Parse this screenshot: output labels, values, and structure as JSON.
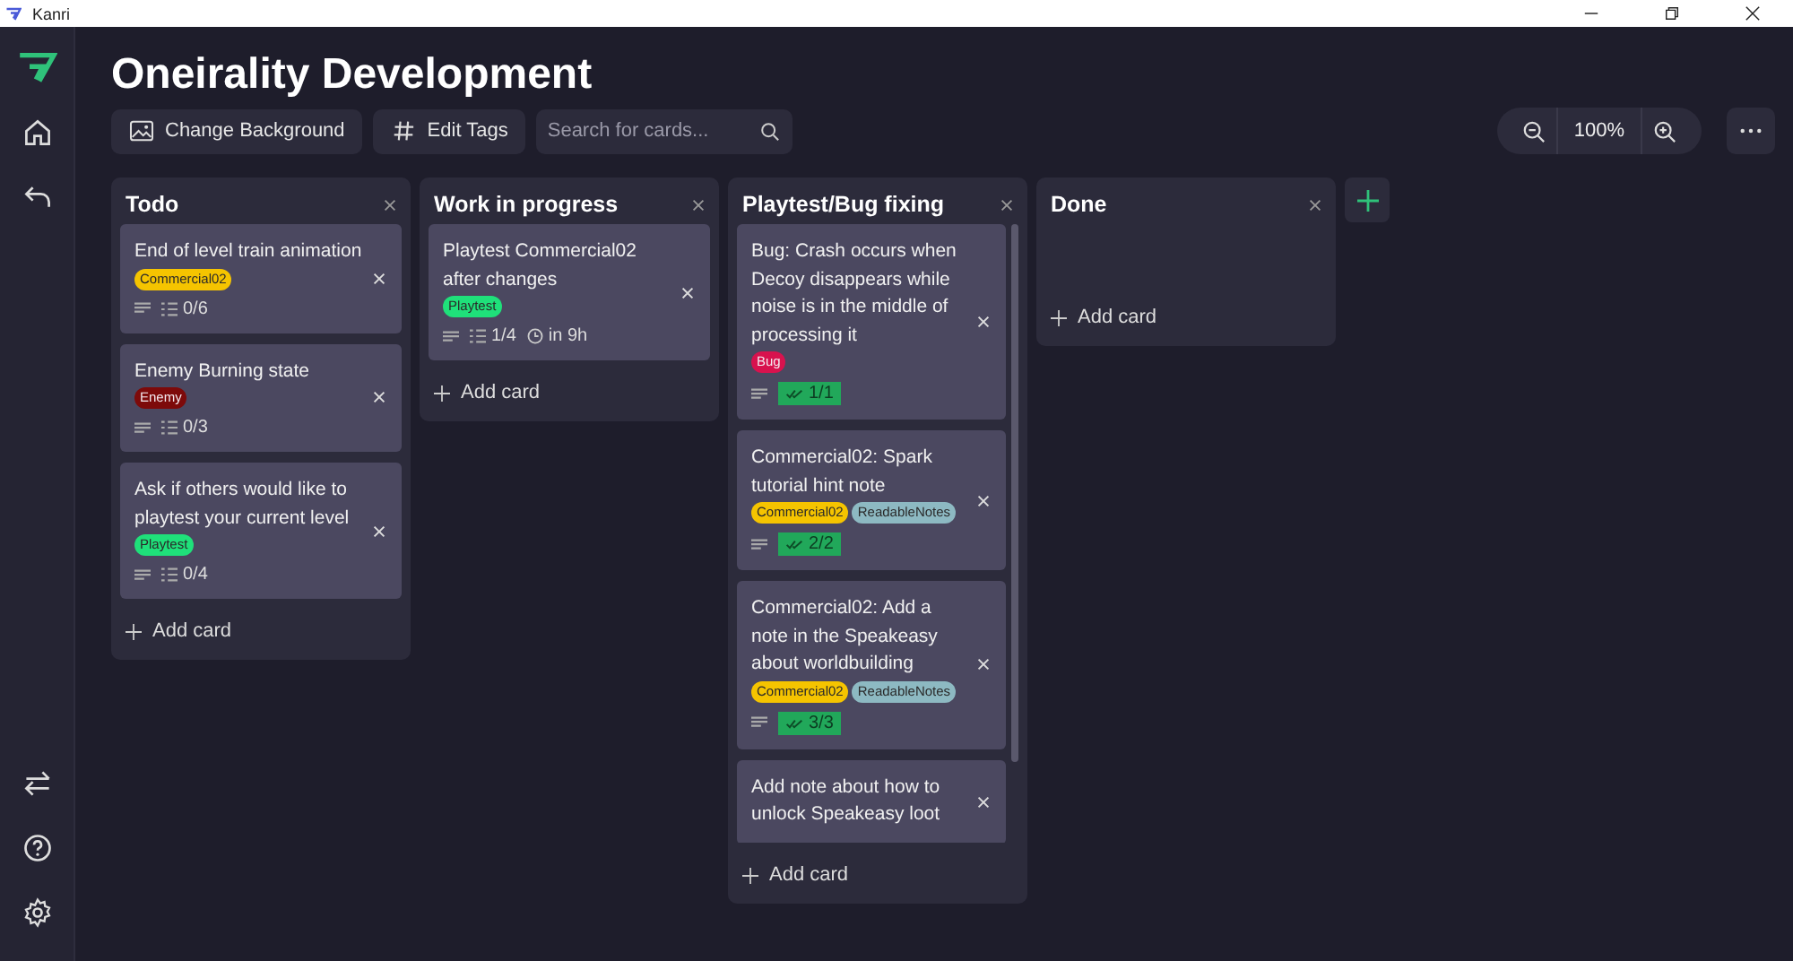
{
  "window": {
    "title": "Kanri"
  },
  "board": {
    "title": "Oneirality Development"
  },
  "toolbar": {
    "change_background": "Change Background",
    "edit_tags": "Edit Tags",
    "search": {
      "placeholder": "Search for cards..."
    },
    "zoom": "100%"
  },
  "columns": [
    {
      "title": "Todo",
      "scrolled": false,
      "add_card": "Add card",
      "cards": [
        {
          "title": "End of level train animation",
          "tags": [
            {
              "label": "Commercial02",
              "color": "#f5c400"
            }
          ],
          "has_description": true,
          "checklist": {
            "text": "0/6",
            "complete": false
          }
        },
        {
          "title": "Enemy Burning state",
          "tags": [
            {
              "label": "Enemy",
              "color": "#7d0a0a"
            }
          ],
          "has_description": true,
          "checklist": {
            "text": "0/3",
            "complete": false
          }
        },
        {
          "title": "Ask if others would like to playtest your current level",
          "tags": [
            {
              "label": "Playtest",
              "color": "#1fe07a"
            }
          ],
          "has_description": true,
          "checklist": {
            "text": "0/4",
            "complete": false
          }
        }
      ]
    },
    {
      "title": "Work in progress",
      "scrolled": false,
      "add_card": "Add card",
      "cards": [
        {
          "title": "Playtest Commercial02 after changes",
          "tags": [
            {
              "label": "Playtest",
              "color": "#1fe07a"
            }
          ],
          "has_description": true,
          "checklist": {
            "text": "1/4",
            "complete": false
          },
          "due": "in 9h"
        }
      ]
    },
    {
      "title": "Playtest/Bug fixing",
      "scrolled": true,
      "add_card": "Add card",
      "cards": [
        {
          "title": "Bug: Crash occurs when Decoy disappears while noise is in the middle of processing it",
          "tags": [
            {
              "label": "Bug",
              "color": "#d8124e"
            }
          ],
          "has_description": true,
          "checklist": {
            "text": "1/1",
            "complete": true
          }
        },
        {
          "title": "Commercial02: Spark tutorial hint note",
          "tags": [
            {
              "label": "Commercial02",
              "color": "#f5c400"
            },
            {
              "label": "ReadableNotes",
              "color": "#8db9c2"
            }
          ],
          "has_description": true,
          "checklist": {
            "text": "2/2",
            "complete": true
          }
        },
        {
          "title": "Commercial02: Add a note in the Speakeasy about worldbuilding",
          "tags": [
            {
              "label": "Commercial02",
              "color": "#f5c400"
            },
            {
              "label": "ReadableNotes",
              "color": "#8db9c2"
            }
          ],
          "has_description": true,
          "checklist": {
            "text": "3/3",
            "complete": true
          }
        },
        {
          "title": "Add note about how to unlock Speakeasy loot",
          "has_description": false
        }
      ]
    },
    {
      "title": "Done",
      "scrolled": false,
      "add_card": "Add card"
    }
  ]
}
